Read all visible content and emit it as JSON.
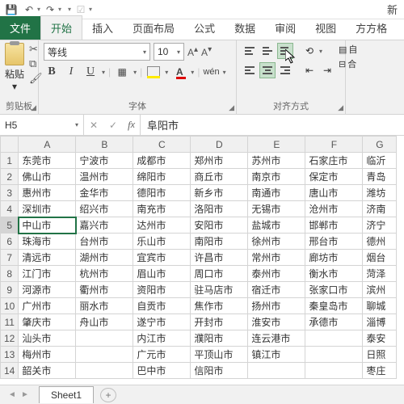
{
  "qat": {
    "title_fragment": "新"
  },
  "tabs": {
    "file": "文件",
    "home": "开始",
    "insert": "插入",
    "layout": "页面布局",
    "formulas": "公式",
    "data": "数据",
    "review": "审阅",
    "view": "视图",
    "fangfang": "方方格"
  },
  "ribbon": {
    "clipboard": {
      "paste": "粘贴",
      "label": "剪贴板"
    },
    "font": {
      "name": "等线",
      "size": "10",
      "label": "字体",
      "wen": "wén"
    },
    "align": {
      "label": "对齐方式",
      "wrap": "自",
      "merge": "合"
    }
  },
  "namebox": {
    "ref": "H5",
    "formula": "阜阳市"
  },
  "columns": [
    "A",
    "B",
    "C",
    "D",
    "E",
    "F",
    "G"
  ],
  "rows": [
    [
      "东莞市",
      "宁波市",
      "成都市",
      "郑州市",
      "苏州市",
      "石家庄市",
      "临沂"
    ],
    [
      "佛山市",
      "温州市",
      "绵阳市",
      "商丘市",
      "南京市",
      "保定市",
      "青岛"
    ],
    [
      "惠州市",
      "金华市",
      "德阳市",
      "新乡市",
      "南通市",
      "唐山市",
      "潍坊"
    ],
    [
      "深圳市",
      "绍兴市",
      "南充市",
      "洛阳市",
      "无锡市",
      "沧州市",
      "济南"
    ],
    [
      "中山市",
      "嘉兴市",
      "达州市",
      "安阳市",
      "盐城市",
      "邯郸市",
      "济宁"
    ],
    [
      "珠海市",
      "台州市",
      "乐山市",
      "南阳市",
      "徐州市",
      "邢台市",
      "德州"
    ],
    [
      "清远市",
      "湖州市",
      "宜宾市",
      "许昌市",
      "常州市",
      "廊坊市",
      "烟台"
    ],
    [
      "江门市",
      "杭州市",
      "眉山市",
      "周口市",
      "泰州市",
      "衡水市",
      "菏泽"
    ],
    [
      "河源市",
      "衢州市",
      "资阳市",
      "驻马店市",
      "宿迁市",
      "张家口市",
      "滨州"
    ],
    [
      "广州市",
      "丽水市",
      "自贡市",
      "焦作市",
      "扬州市",
      "秦皇岛市",
      "聊城"
    ],
    [
      "肇庆市",
      "舟山市",
      "遂宁市",
      "开封市",
      "淮安市",
      "承德市",
      "淄博"
    ],
    [
      "汕头市",
      "",
      "内江市",
      "濮阳市",
      "连云港市",
      "",
      "泰安"
    ],
    [
      "梅州市",
      "",
      "广元市",
      "平顶山市",
      "镇江市",
      "",
      "日照"
    ],
    [
      "韶关市",
      "",
      "巴中市",
      "信阳市",
      "",
      "",
      "枣庄"
    ]
  ],
  "sheet": {
    "name": "Sheet1"
  }
}
